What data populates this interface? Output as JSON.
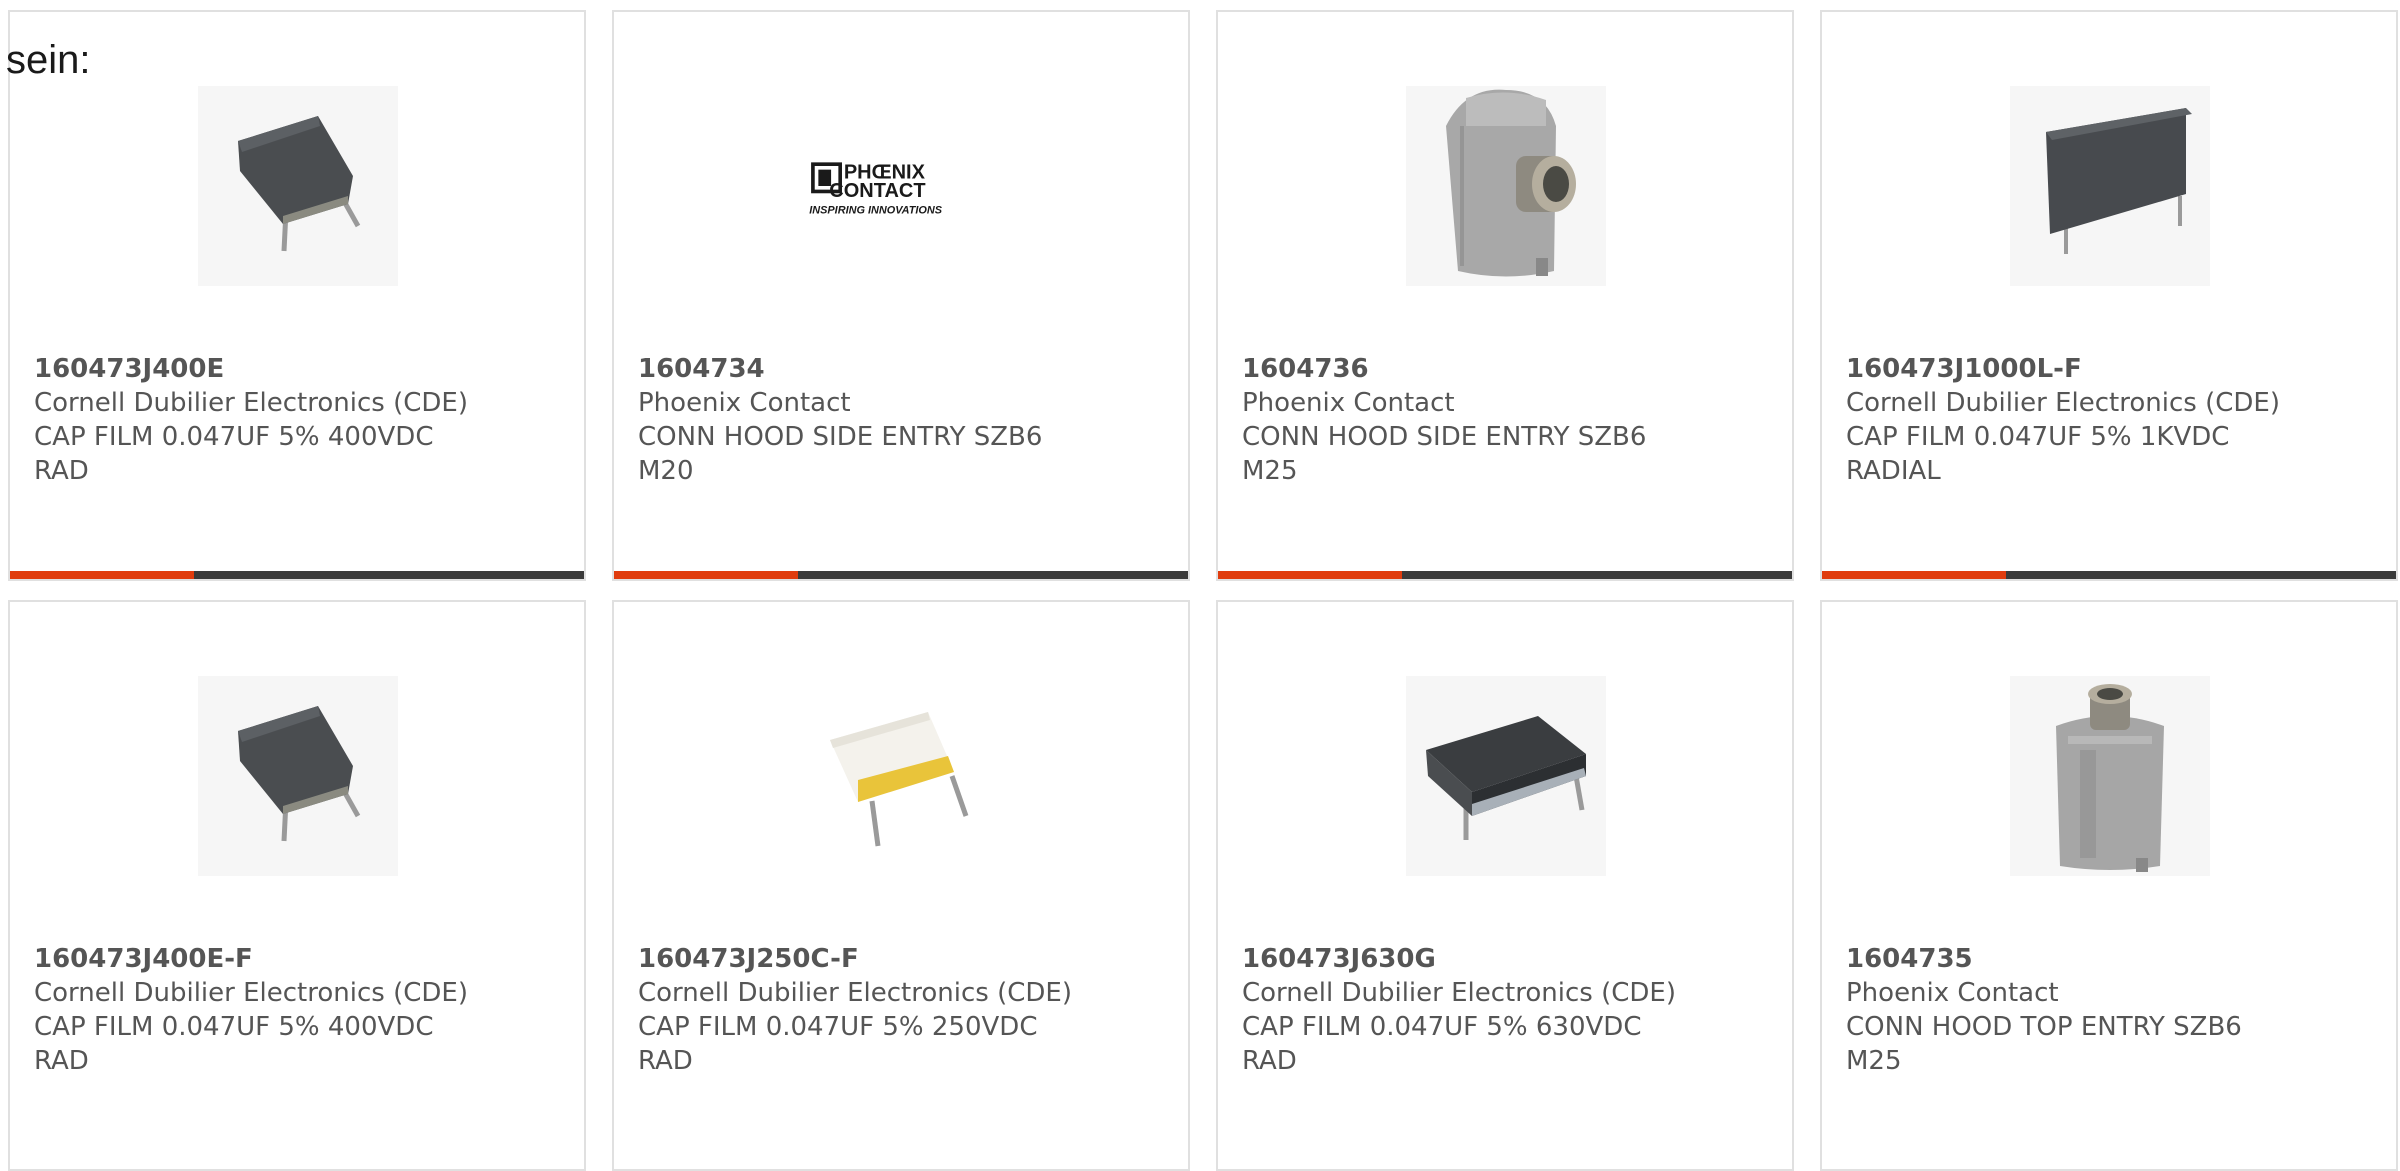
{
  "intro_text": "sein:",
  "colors": {
    "accent": "#e03c0e",
    "bar": "#3a3a3a",
    "text": "#555555",
    "border": "#e0e0e0"
  },
  "products": [
    {
      "part_number": "160473J400E",
      "manufacturer": "Cornell Dubilier Electronics (CDE)",
      "desc_line1": "CAP FILM 0.047UF 5% 400VDC",
      "desc_line2": "RAD",
      "image": "capacitor-film-dark"
    },
    {
      "part_number": "1604734",
      "manufacturer": "Phoenix Contact",
      "desc_line1": "CONN HOOD SIDE ENTRY SZB6",
      "desc_line2": "M20",
      "image": "phoenix-contact-logo",
      "logo_text_1": "PHŒNIX",
      "logo_text_2": "CONTACT",
      "logo_tagline": "INSPIRING INNOVATIONS"
    },
    {
      "part_number": "1604736",
      "manufacturer": "Phoenix Contact",
      "desc_line1": "CONN HOOD SIDE ENTRY SZB6",
      "desc_line2": "M25",
      "image": "connector-hood-side"
    },
    {
      "part_number": "160473J1000L-F",
      "manufacturer": "Cornell Dubilier Electronics (CDE)",
      "desc_line1": "CAP FILM 0.047UF 5% 1KVDC",
      "desc_line2": "RADIAL",
      "image": "capacitor-film-wide"
    },
    {
      "part_number": "160473J400E-F",
      "manufacturer": "Cornell Dubilier Electronics (CDE)",
      "desc_line1": "CAP FILM 0.047UF 5% 400VDC",
      "desc_line2": "RAD",
      "image": "capacitor-film-dark"
    },
    {
      "part_number": "160473J250C-F",
      "manufacturer": "Cornell Dubilier Electronics (CDE)",
      "desc_line1": "CAP FILM 0.047UF 5% 250VDC",
      "desc_line2": "RAD",
      "image": "capacitor-film-white"
    },
    {
      "part_number": "160473J630G",
      "manufacturer": "Cornell Dubilier Electronics (CDE)",
      "desc_line1": "CAP FILM 0.047UF 5% 630VDC",
      "desc_line2": "RAD",
      "image": "capacitor-film-box"
    },
    {
      "part_number": "1604735",
      "manufacturer": "Phoenix Contact",
      "desc_line1": "CONN HOOD TOP ENTRY SZB6",
      "desc_line2": "M25",
      "image": "connector-hood-top"
    }
  ]
}
